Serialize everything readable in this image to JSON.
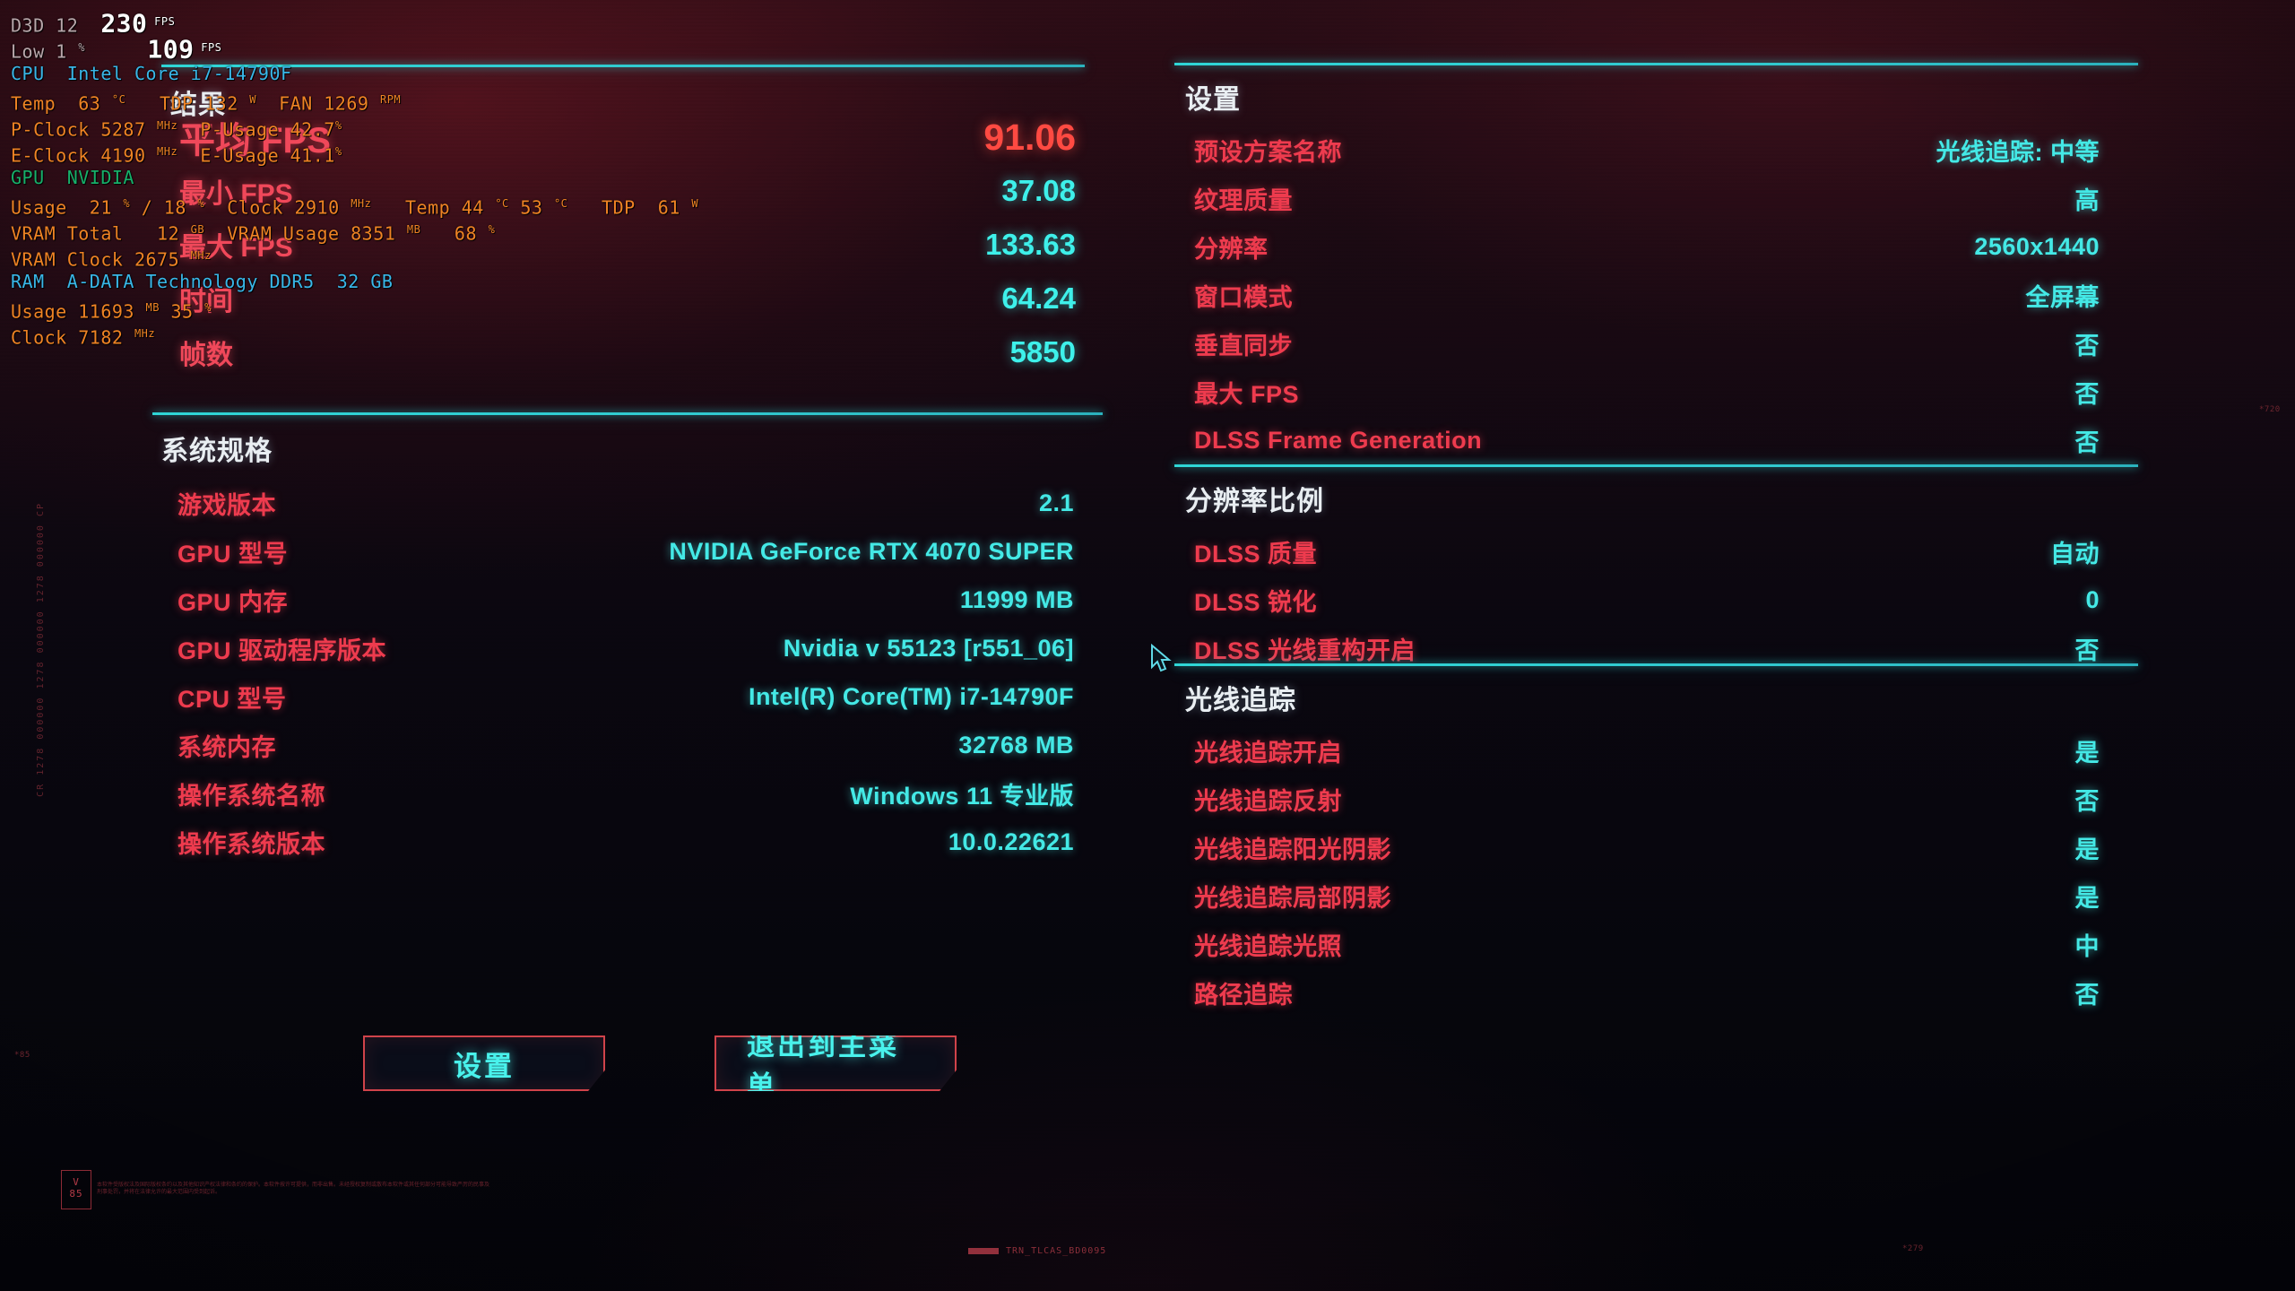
{
  "osd": {
    "lines": [
      [
        {
          "t": "D3D 12  ",
          "c": "c-grey"
        },
        {
          "t": "230",
          "c": "c-white big"
        },
        {
          "t": " FPS",
          "c": "c-white unit"
        }
      ],
      [
        {
          "t": "Low 1 ",
          "c": "c-grey"
        },
        {
          "t": "%",
          "c": "c-grey unit"
        },
        {
          "t": "    109",
          "c": "c-white big"
        },
        {
          "t": " FPS",
          "c": "c-white unit"
        }
      ],
      [
        {
          "t": "CPU  Intel Core i7-14790F",
          "c": "c-blue"
        }
      ],
      [
        {
          "t": "Temp  63 ",
          "c": "c-org"
        },
        {
          "t": "°C",
          "c": "c-org unit"
        },
        {
          "t": "   TDP 132 ",
          "c": "c-org"
        },
        {
          "t": "W",
          "c": "c-org unit"
        },
        {
          "t": "  FAN 1269 ",
          "c": "c-org"
        },
        {
          "t": "RPM",
          "c": "c-org unit"
        }
      ],
      [
        {
          "t": "P-Clock 5287 ",
          "c": "c-org"
        },
        {
          "t": "MHz",
          "c": "c-org unit"
        },
        {
          "t": "  P-Usage 42.7",
          "c": "c-org"
        },
        {
          "t": "%",
          "c": "c-org unit"
        }
      ],
      [
        {
          "t": "E-Clock 4190 ",
          "c": "c-org"
        },
        {
          "t": "MHz",
          "c": "c-org unit"
        },
        {
          "t": "  E-Usage 41.1",
          "c": "c-org"
        },
        {
          "t": "%",
          "c": "c-org unit"
        }
      ],
      [
        {
          "t": "GPU  NVIDIA",
          "c": "c-green"
        }
      ],
      [
        {
          "t": "Usage  21 ",
          "c": "c-org"
        },
        {
          "t": "%",
          "c": "c-org unit"
        },
        {
          "t": " / 18 ",
          "c": "c-org"
        },
        {
          "t": "%",
          "c": "c-org unit"
        },
        {
          "t": "  Clock 2910 ",
          "c": "c-org"
        },
        {
          "t": "MHz",
          "c": "c-org unit"
        },
        {
          "t": "   Temp 44 ",
          "c": "c-org"
        },
        {
          "t": "°C",
          "c": "c-org unit"
        },
        {
          "t": " 53 ",
          "c": "c-org"
        },
        {
          "t": "°C",
          "c": "c-org unit"
        },
        {
          "t": "   TDP  61 ",
          "c": "c-org"
        },
        {
          "t": "W",
          "c": "c-org unit"
        }
      ],
      [
        {
          "t": "VRAM Total   12 ",
          "c": "c-org"
        },
        {
          "t": "GB",
          "c": "c-org unit"
        },
        {
          "t": "  VRAM Usage 8351 ",
          "c": "c-org"
        },
        {
          "t": "MB",
          "c": "c-org unit"
        },
        {
          "t": "   68 ",
          "c": "c-org"
        },
        {
          "t": "%",
          "c": "c-org unit"
        }
      ],
      [
        {
          "t": "VRAM Clock 2675 ",
          "c": "c-org"
        },
        {
          "t": "MHz",
          "c": "c-org unit"
        }
      ],
      [
        {
          "t": "RAM  A-DATA Technology DDR5  32 GB",
          "c": "c-blue"
        }
      ],
      [
        {
          "t": "Usage 11693 ",
          "c": "c-org"
        },
        {
          "t": "MB",
          "c": "c-org unit"
        },
        {
          "t": " 35 ",
          "c": "c-org"
        },
        {
          "t": "%",
          "c": "c-org unit"
        }
      ],
      [
        {
          "t": "Clock 7182 ",
          "c": "c-org"
        },
        {
          "t": "MHz",
          "c": "c-org unit"
        }
      ]
    ]
  },
  "results": {
    "title": "结果",
    "rows": [
      {
        "label": "平均 FPS",
        "value": "91.06",
        "hero": true
      },
      {
        "label": "最小 FPS",
        "value": "37.08",
        "hero": false
      },
      {
        "label": "最大 FPS",
        "value": "133.63",
        "hero": false
      },
      {
        "label": "时间",
        "value": "64.24",
        "hero": false
      },
      {
        "label": "帧数",
        "value": "5850",
        "hero": false
      }
    ]
  },
  "specs": {
    "title": "系统规格",
    "rows": [
      {
        "label": "游戏版本",
        "value": "2.1"
      },
      {
        "label": "GPU 型号",
        "value": "NVIDIA GeForce RTX 4070 SUPER"
      },
      {
        "label": "GPU 内存",
        "value": "11999 MB"
      },
      {
        "label": "GPU 驱动程序版本",
        "value": "Nvidia v 55123 [r551_06]"
      },
      {
        "label": "CPU 型号",
        "value": "Intel(R) Core(TM) i7-14790F"
      },
      {
        "label": "系统内存",
        "value": "32768 MB"
      },
      {
        "label": "操作系统名称",
        "value": "Windows 11 专业版"
      },
      {
        "label": "操作系统版本",
        "value": "10.0.22621"
      }
    ]
  },
  "settings": {
    "title": "设置",
    "rows": [
      {
        "label": "预设方案名称",
        "value": "光线追踪: 中等"
      },
      {
        "label": "纹理质量",
        "value": "高"
      },
      {
        "label": "分辨率",
        "value": "2560x1440"
      },
      {
        "label": "窗口模式",
        "value": "全屏幕"
      },
      {
        "label": "垂直同步",
        "value": "否"
      },
      {
        "label": "最大 FPS",
        "value": "否"
      },
      {
        "label": "DLSS Frame Generation",
        "value": "否"
      }
    ]
  },
  "dlss": {
    "title": "分辨率比例",
    "rows": [
      {
        "label": "DLSS 质量",
        "value": "自动"
      },
      {
        "label": "DLSS 锐化",
        "value": "0"
      },
      {
        "label": "DLSS 光线重构开启",
        "value": "否"
      }
    ]
  },
  "raytracing": {
    "title": "光线追踪",
    "rows": [
      {
        "label": "光线追踪开启",
        "value": "是"
      },
      {
        "label": "光线追踪反射",
        "value": "否"
      },
      {
        "label": "光线追踪阳光阴影",
        "value": "是"
      },
      {
        "label": "光线追踪局部阴影",
        "value": "是"
      },
      {
        "label": "光线追踪光照",
        "value": "中"
      },
      {
        "label": "路径追踪",
        "value": "否"
      }
    ]
  },
  "buttons": {
    "settings_label": "设置",
    "exit_label": "退出到主菜单"
  },
  "chrome": {
    "vertical_code": "CR 1278 000000 1278 000000 1278 000000 CP",
    "version_badge": "V\n85",
    "legal": "本软件受版权法及国际版权条约以及其他知识产权法律和条约的保护。本软件按许可提供，而非出售。未经授权复制或散布本软件或其任何部分可能导致严厉的民事及刑事处罚，并将在法律允许的最大范围内受到起诉。",
    "bottom_code": "TRN_TLCAS_BD0095",
    "corner_tl": "*720",
    "corner_left": "*85",
    "corner_bottom": "*279"
  },
  "colors": {
    "accent_cyan": "#44e9e6",
    "accent_red": "#ee3b4e",
    "hero_red": "#ff4a42",
    "rule_cyan": "#2fd6d6",
    "osd_orange": "#ef8324",
    "osd_blue": "#39b7e8",
    "osd_green": "#17b06a"
  }
}
